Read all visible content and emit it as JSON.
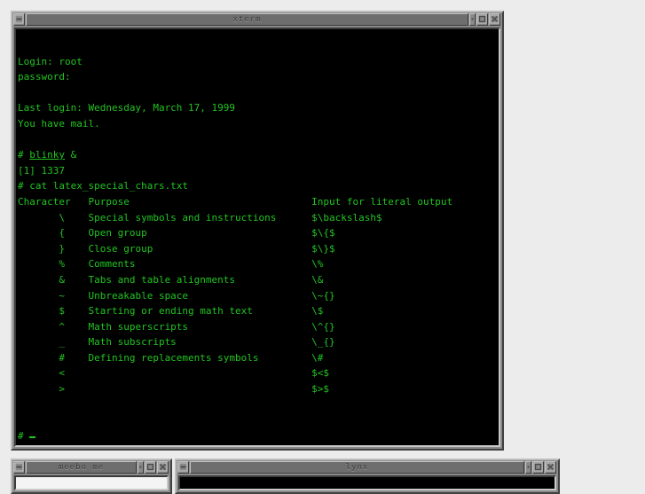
{
  "desktop": {
    "background_color": "#ececec"
  },
  "windows": {
    "xterm": {
      "title": "xterm",
      "menu_icon": "window-menu-icon",
      "buttons": [
        {
          "name": "minimize-button",
          "icon": "minimize-icon"
        },
        {
          "name": "maximize-button",
          "icon": "maximize-icon"
        },
        {
          "name": "close-button",
          "icon": "close-icon"
        }
      ],
      "foreground_color": "#22c422",
      "background_color": "#000000",
      "lines": [
        "",
        "Login: root",
        "password:",
        "",
        "Last login: Wednesday, March 17, 1999",
        "You have mail.",
        "",
        "# blinky &",
        "[1] 1337",
        "# cat latex_special_chars.txt"
      ],
      "command_underlined": "blinky",
      "prompt": "# ",
      "cursor": "_"
    },
    "meebo": {
      "title": "meebo me",
      "menu_icon": "window-menu-icon",
      "buttons": [
        {
          "name": "minimize-button",
          "icon": "minimize-icon"
        },
        {
          "name": "maximize-button",
          "icon": "maximize-icon"
        },
        {
          "name": "close-button",
          "icon": "close-icon"
        }
      ],
      "background_color": "#f4f4f4"
    },
    "lynx": {
      "title": "lynx",
      "menu_icon": "window-menu-icon",
      "buttons": [
        {
          "name": "minimize-button",
          "icon": "minimize-icon"
        },
        {
          "name": "maximize-button",
          "icon": "maximize-icon"
        },
        {
          "name": "close-button",
          "icon": "close-icon"
        }
      ],
      "background_color": "#000000"
    }
  },
  "table": {
    "headers": [
      "Character",
      "Purpose",
      "Input for literal output"
    ],
    "rows": [
      {
        "character": "\\",
        "purpose": "Special symbols and instructions",
        "input": "$\\backslash$"
      },
      {
        "character": "{",
        "purpose": "Open group",
        "input": "$\\{$"
      },
      {
        "character": "}",
        "purpose": "Close group",
        "input": "$\\}$"
      },
      {
        "character": "%",
        "purpose": "Comments",
        "input": "\\%"
      },
      {
        "character": "&",
        "purpose": "Tabs and table alignments",
        "input": "\\&"
      },
      {
        "character": "~",
        "purpose": "Unbreakable space",
        "input": "\\~{}"
      },
      {
        "character": "$",
        "purpose": "Starting or ending math text",
        "input": "\\$"
      },
      {
        "character": "^",
        "purpose": "Math superscripts",
        "input": "\\^{}"
      },
      {
        "character": "_",
        "purpose": "Math subscripts",
        "input": "\\_{}"
      },
      {
        "character": "#",
        "purpose": "Defining replacements symbols",
        "input": "\\#"
      },
      {
        "character": "<",
        "purpose": "",
        "input": "$<$"
      },
      {
        "character": ">",
        "purpose": "",
        "input": "$>$"
      }
    ]
  }
}
